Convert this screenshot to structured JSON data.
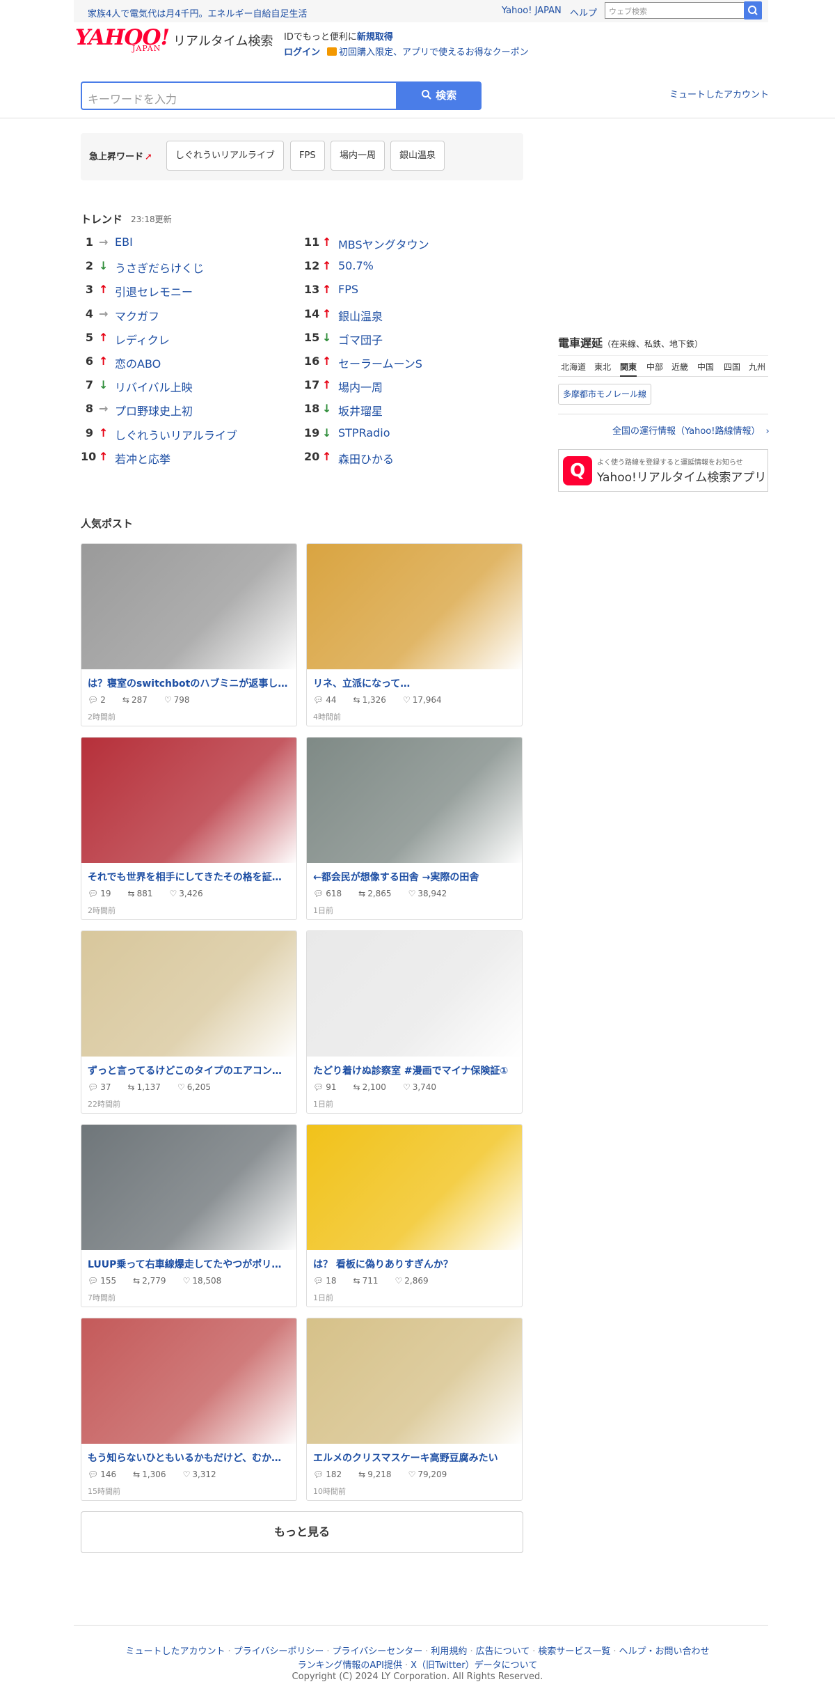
{
  "topbar": {
    "promo": "家族4人で電気代は月4千円。エネルギー自給自足生活",
    "yahoo_japan": "Yahoo! JAPAN",
    "help": "ヘルプ",
    "web_search_placeholder": "ウェブ検索"
  },
  "header": {
    "logo_main": "YAHOO!",
    "logo_sub": "JAPAN",
    "service_name": "リアルタイム検索",
    "id_message": "IDでもっと便利に",
    "signup": "新規取得",
    "login": "ログイン",
    "coupon": "初回購入限定、アプリで使えるお得なクーポン"
  },
  "search": {
    "placeholder": "キーワードを入力",
    "button": "検索",
    "muted_accounts": "ミュートしたアカウント"
  },
  "rising": {
    "label": "急上昇ワード",
    "words": [
      "しぐれういリアルライブ",
      "FPS",
      "場内一周",
      "銀山温泉"
    ]
  },
  "trends": {
    "title": "トレンド",
    "updated": "23:18更新",
    "items": [
      {
        "rank": "1",
        "dir": "flat",
        "word": "EBI"
      },
      {
        "rank": "2",
        "dir": "down",
        "word": "うさぎだらけくじ"
      },
      {
        "rank": "3",
        "dir": "up",
        "word": "引退セレモニー"
      },
      {
        "rank": "4",
        "dir": "flat",
        "word": "マクガフ"
      },
      {
        "rank": "5",
        "dir": "up",
        "word": "レディクレ"
      },
      {
        "rank": "6",
        "dir": "up",
        "word": "恋のABO"
      },
      {
        "rank": "7",
        "dir": "down",
        "word": "リバイバル上映"
      },
      {
        "rank": "8",
        "dir": "flat",
        "word": "プロ野球史上初"
      },
      {
        "rank": "9",
        "dir": "up",
        "word": "しぐれういリアルライブ"
      },
      {
        "rank": "10",
        "dir": "up",
        "word": "若冲と応挙"
      },
      {
        "rank": "11",
        "dir": "up",
        "word": "MBSヤングタウン"
      },
      {
        "rank": "12",
        "dir": "up",
        "word": "50.7%"
      },
      {
        "rank": "13",
        "dir": "up",
        "word": "FPS"
      },
      {
        "rank": "14",
        "dir": "up",
        "word": "銀山温泉"
      },
      {
        "rank": "15",
        "dir": "down",
        "word": "ゴマ団子"
      },
      {
        "rank": "16",
        "dir": "up",
        "word": "セーラームーンS"
      },
      {
        "rank": "17",
        "dir": "up",
        "word": "場内一周"
      },
      {
        "rank": "18",
        "dir": "down",
        "word": "坂井瑠星"
      },
      {
        "rank": "19",
        "dir": "down",
        "word": "STPRadio"
      },
      {
        "rank": "20",
        "dir": "up",
        "word": "森田ひかる"
      }
    ]
  },
  "popular": {
    "title": "人気ポスト",
    "posts": [
      {
        "title": "は？寝室のswitchbotのハブミニが返事し…",
        "replies": "2",
        "reposts": "287",
        "likes": "798",
        "time": "2時間前",
        "color": "#9a9a9a"
      },
      {
        "title": "リネ、立派になって…",
        "replies": "44",
        "reposts": "1,326",
        "likes": "17,964",
        "time": "4時間前",
        "color": "#d9a441"
      },
      {
        "title": "それでも世界を相手にしてきたその格を証…",
        "replies": "19",
        "reposts": "881",
        "likes": "3,426",
        "time": "2時間前",
        "color": "#b6303a"
      },
      {
        "title": "←都会民が想像する田舎 →実際の田舎",
        "replies": "618",
        "reposts": "2,865",
        "likes": "38,942",
        "time": "1日前",
        "color": "#7f8a86"
      },
      {
        "title": "ずっと言ってるけどこのタイプのエアコン…",
        "replies": "37",
        "reposts": "1,137",
        "likes": "6,205",
        "time": "22時間前",
        "color": "#d8c79c"
      },
      {
        "title": "たどり着けぬ診察室 #漫画でマイナ保険証①",
        "replies": "91",
        "reposts": "2,100",
        "likes": "3,740",
        "time": "1日前",
        "color": "#e9e9e9"
      },
      {
        "title": "LUUP乗って右車線爆走してたやつがポリス…",
        "replies": "155",
        "reposts": "2,779",
        "likes": "18,508",
        "time": "7時間前",
        "color": "#6f767a"
      },
      {
        "title": "は？ 看板に偽りありすぎんか？",
        "replies": "18",
        "reposts": "711",
        "likes": "2,869",
        "time": "1日前",
        "color": "#f1c21a"
      },
      {
        "title": "もう知らないひともいるかもだけど、むか…",
        "replies": "146",
        "reposts": "1,306",
        "likes": "3,312",
        "time": "15時間前",
        "color": "#c45a5a"
      },
      {
        "title": "エルメのクリスマスケーキ高野豆腐みたい",
        "replies": "182",
        "reposts": "9,218",
        "likes": "79,209",
        "time": "10時間前",
        "color": "#d6c189"
      }
    ],
    "more": "もっと見る"
  },
  "train": {
    "title": "電車遅延",
    "subtitle": "（在来線、私鉄、地下鉄）",
    "regions": [
      "北海道",
      "東北",
      "関東",
      "中部",
      "近畿",
      "中国",
      "四国",
      "九州"
    ],
    "selected": "関東",
    "line": "多摩都市モノレール線",
    "link": "全国の運行情報（Yahoo!路線情報）"
  },
  "app": {
    "sub": "よく使う路線を登録すると運延情報をお知らせ",
    "name": "Yahoo!リアルタイム検索アプリ"
  },
  "footer": {
    "links1": [
      "ミュートしたアカウント",
      "プライバシーポリシー",
      "プライバシーセンター",
      "利用規約",
      "広告について",
      "検索サービス一覧",
      "ヘルプ・お問い合わせ"
    ],
    "links2": [
      "ランキング情報のAPI提供",
      "X（旧Twitter）データについて"
    ],
    "copyright": "Copyright (C) 2024 LY Corporation. All Rights Reserved."
  }
}
